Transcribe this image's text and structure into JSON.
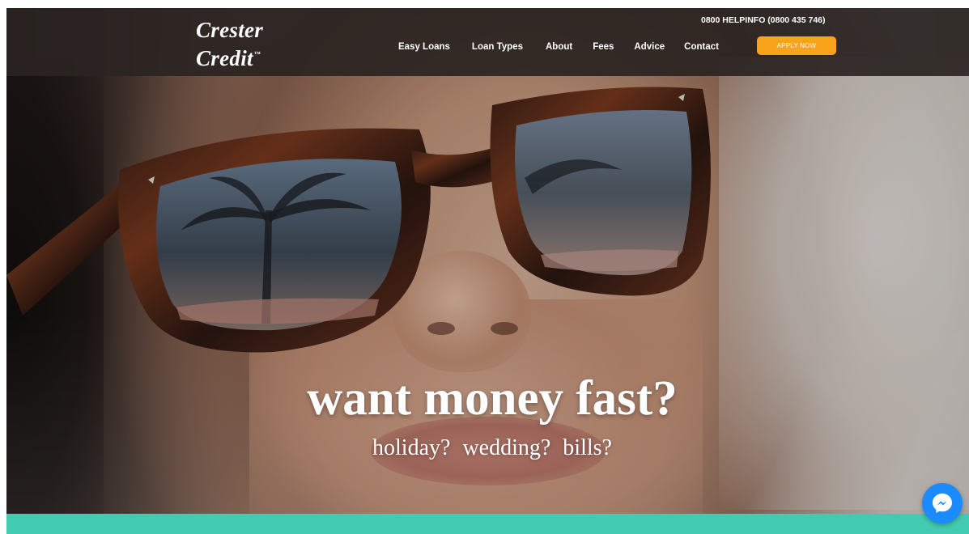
{
  "brand": {
    "line1": "Crester",
    "line2": "Credit",
    "tm": "™"
  },
  "header": {
    "phone": "0800 HELPINFO (0800 435 746)",
    "apply_label": "APPLY NOW",
    "nav": [
      {
        "label": "Easy Loans"
      },
      {
        "label": "Loan Types"
      },
      {
        "label": "About"
      },
      {
        "label": "Fees"
      },
      {
        "label": "Advice"
      },
      {
        "label": "Contact"
      }
    ]
  },
  "hero": {
    "headline": "want money fast?",
    "subline": "holiday?  wedding?  bills?"
  },
  "icons": {
    "chat": "messenger-icon"
  },
  "colors": {
    "header_bg": "#2a2624",
    "accent": "#f9a31b",
    "band": "#43cbb1",
    "messenger": "#1a8cff"
  }
}
